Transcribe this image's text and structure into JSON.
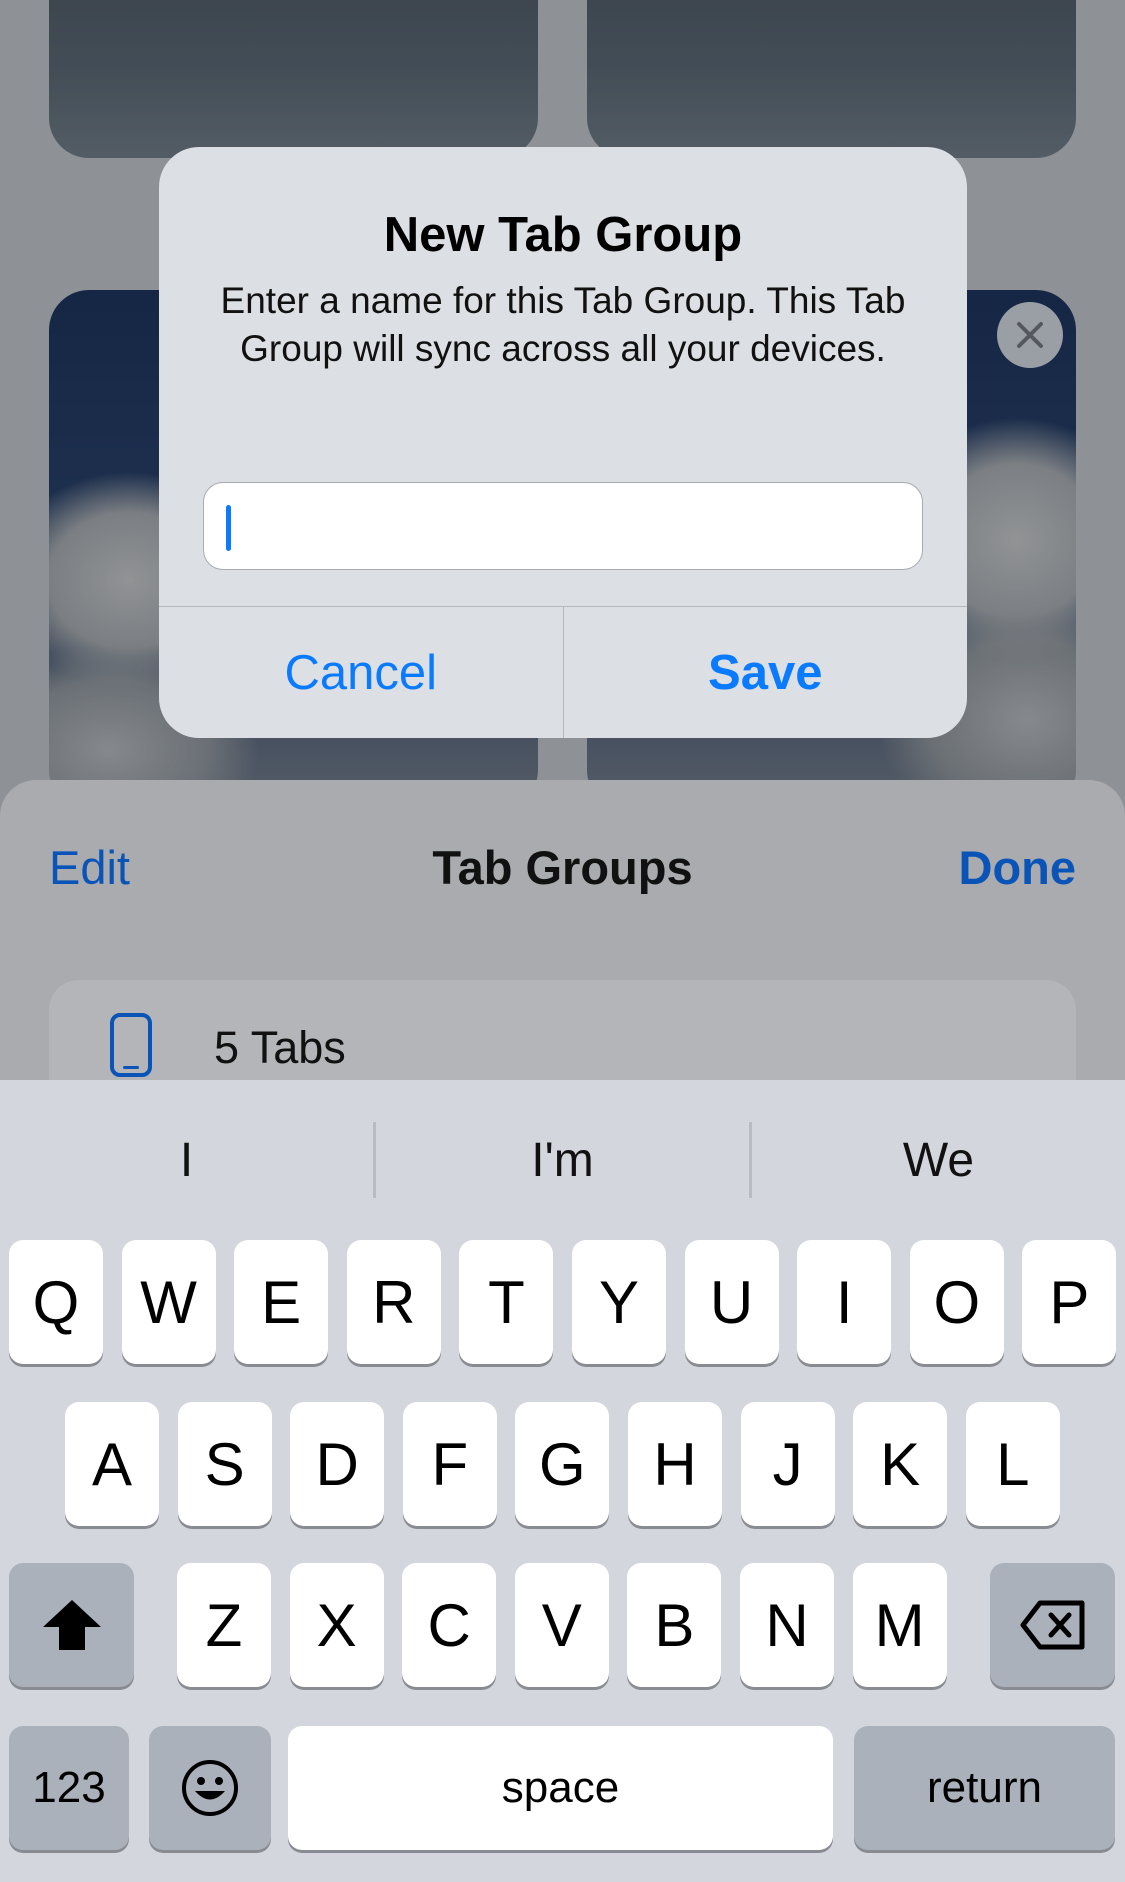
{
  "alert": {
    "title": "New Tab Group",
    "message": "Enter a name for this Tab Group. This Tab Group will sync across all your devices.",
    "input_value": "",
    "cancel_label": "Cancel",
    "save_label": "Save"
  },
  "sheet": {
    "edit_label": "Edit",
    "title": "Tab Groups",
    "done_label": "Done",
    "group_label": "5 Tabs"
  },
  "keyboard": {
    "suggestions": [
      "I",
      "I'm",
      "We"
    ],
    "row1": [
      "Q",
      "W",
      "E",
      "R",
      "T",
      "Y",
      "U",
      "I",
      "O",
      "P"
    ],
    "row2": [
      "A",
      "S",
      "D",
      "F",
      "G",
      "H",
      "J",
      "K",
      "L"
    ],
    "row3": [
      "Z",
      "X",
      "C",
      "V",
      "B",
      "N",
      "M"
    ],
    "numbers_label": "123",
    "space_label": "space",
    "return_label": "return"
  },
  "colors": {
    "accent": "#0A7AFF",
    "sheet_accent": "#0A54B8"
  },
  "icons": [
    "close-icon",
    "phone-icon",
    "shift-icon",
    "backspace-icon",
    "emoji-icon"
  ]
}
